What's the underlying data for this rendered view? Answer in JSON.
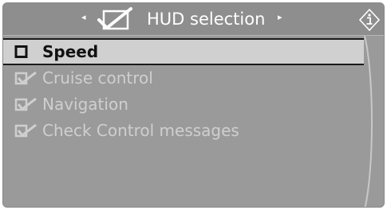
{
  "header": {
    "title": "HUD selection",
    "menu_icon": "checkmark-box-icon",
    "info_icon": "info-icon",
    "nav_left_glyph": "◂",
    "nav_right_glyph": "▸"
  },
  "items": [
    {
      "label": "Speed",
      "state": "unchecked",
      "selected": true
    },
    {
      "label": "Cruise control",
      "state": "checked",
      "selected": false
    },
    {
      "label": "Navigation",
      "state": "checked",
      "selected": false
    },
    {
      "label": "Check Control messages",
      "state": "checked",
      "selected": false
    }
  ],
  "colors": {
    "background": "#9a9a9a",
    "header": "#8e8e8e",
    "highlight": "#d0d0d0",
    "text_selected": "#111111",
    "text_inactive": "#cfcfcf",
    "title_text": "#ffffff"
  }
}
